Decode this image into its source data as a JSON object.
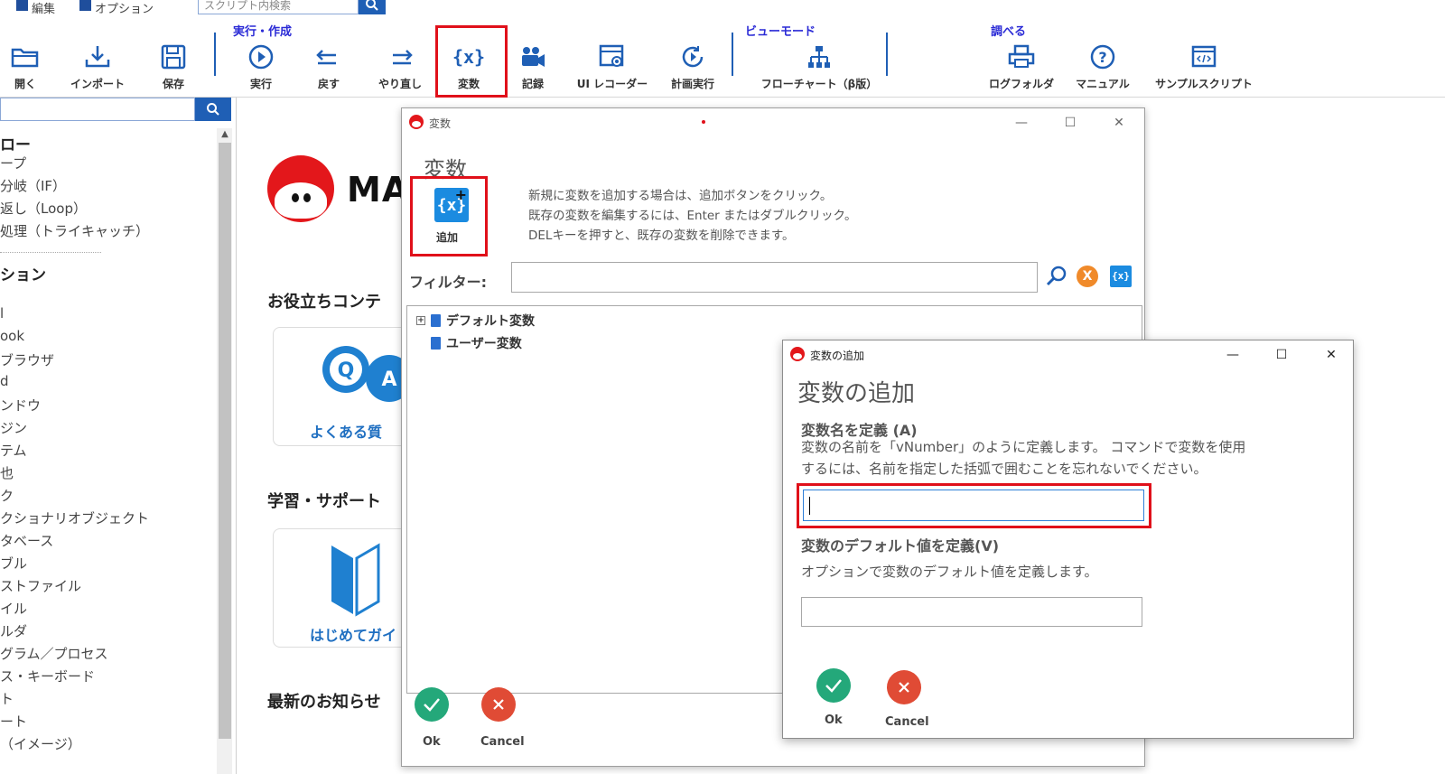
{
  "menubar": {
    "edit": "編集",
    "options": "オプション",
    "script_search_placeholder": "スクリプト内検索"
  },
  "ribbon": {
    "groups": {
      "run_create": "実行・作成",
      "view_mode": "ビューモード",
      "lookup": "調べる"
    },
    "buttons": {
      "open": "開く",
      "import": "インポート",
      "save": "保存",
      "run": "実行",
      "undo": "戻す",
      "redo": "やり直し",
      "variables": "変数",
      "record": "記録",
      "ui_recorder": "UI レコーダー",
      "schedule": "計画実行",
      "flowchart": "フローチャート（β版）",
      "log_folder": "ログフォルダ",
      "manual": "マニュアル",
      "sample_scripts": "サンプルスクリプト"
    }
  },
  "left_panel": {
    "items": [
      {
        "text": "ロー",
        "kind": "head"
      },
      {
        "text": "ープ",
        "kind": "item"
      },
      {
        "text": "分岐（IF）",
        "kind": "item"
      },
      {
        "text": "返し（Loop）",
        "kind": "item"
      },
      {
        "text": "処理（トライキャッチ）",
        "kind": "item"
      },
      {
        "text": "ション",
        "kind": "head"
      },
      {
        "text": "l",
        "kind": "item"
      },
      {
        "text": "ook",
        "kind": "item"
      },
      {
        "text": "ブラウザ",
        "kind": "item"
      },
      {
        "text": "d",
        "kind": "item"
      },
      {
        "text": "ンドウ",
        "kind": "item"
      },
      {
        "text": "ジン",
        "kind": "item"
      },
      {
        "text": "テム",
        "kind": "item"
      },
      {
        "text": "也",
        "kind": "item"
      },
      {
        "text": "ク",
        "kind": "item"
      },
      {
        "text": "クショナリオブジェクト",
        "kind": "item"
      },
      {
        "text": "タベース",
        "kind": "item"
      },
      {
        "text": "ブル",
        "kind": "item"
      },
      {
        "text": "ストファイル",
        "kind": "item"
      },
      {
        "text": "イル",
        "kind": "item"
      },
      {
        "text": "ルダ",
        "kind": "item"
      },
      {
        "text": "グラム／プロセス",
        "kind": "item"
      },
      {
        "text": "ス・キーボード",
        "kind": "item"
      },
      {
        "text": "ト",
        "kind": "item"
      },
      {
        "text": "ート",
        "kind": "item"
      },
      {
        "text": "（イメージ）",
        "kind": "item"
      }
    ]
  },
  "main": {
    "logo_text": "MA",
    "useful_content": "お役立ちコンテ",
    "faq_label": "よくある質",
    "learning_support": "学習・サポート",
    "beginner_guide": "はじめてガイ",
    "latest_news": "最新のお知らせ"
  },
  "variables_dialog": {
    "title": "変数",
    "heading": "変数",
    "add_label": "追加",
    "help_lines": [
      "新規に変数を追加する場合は、追加ボタンをクリック。",
      "既存の変数を編集するには、Enter またはダブルクリック。",
      "DELキーを押すと、既存の変数を削除できます。"
    ],
    "filter_label": "フィルター:",
    "filter_value": "",
    "tree": [
      {
        "label": "デフォルト変数",
        "expander": "+"
      },
      {
        "label": "ユーザー変数",
        "expander": ""
      }
    ],
    "ok": "Ok",
    "cancel": "Cancel"
  },
  "add_variable_dialog": {
    "title": "変数の追加",
    "heading": "変数の追加",
    "name_title": "変数名を定義 (A)",
    "name_desc_lines": [
      "変数の名前を「vNumber」のように定義します。 コマンドで変数を使用",
      "するには、名前を指定した括弧で囲むことを忘れないでください。"
    ],
    "name_value": "",
    "default_title": "変数のデフォルト値を定義(V)",
    "default_desc": "オプションで変数のデフォルト値を定義します。",
    "default_value": "",
    "ok": "Ok",
    "cancel": "Cancel"
  },
  "colors": {
    "accent_blue": "#1f5fb5",
    "highlight_red": "#e0101a",
    "ok_green": "#24a87a",
    "cancel_red": "#e04b35",
    "group_label_blue": "#2b2bd6"
  },
  "icons": {
    "open": "folder-icon",
    "import": "download-icon",
    "save": "save-icon",
    "run": "play-icon",
    "undo": "undo-icon",
    "redo": "redo-icon",
    "variables": "variable-braces-icon",
    "record": "camera-icon",
    "ui_recorder": "window-record-icon",
    "schedule": "clock-icon",
    "flowchart": "flowchart-icon",
    "log_folder": "printer-icon",
    "manual": "help-icon",
    "sample_scripts": "code-icon"
  }
}
